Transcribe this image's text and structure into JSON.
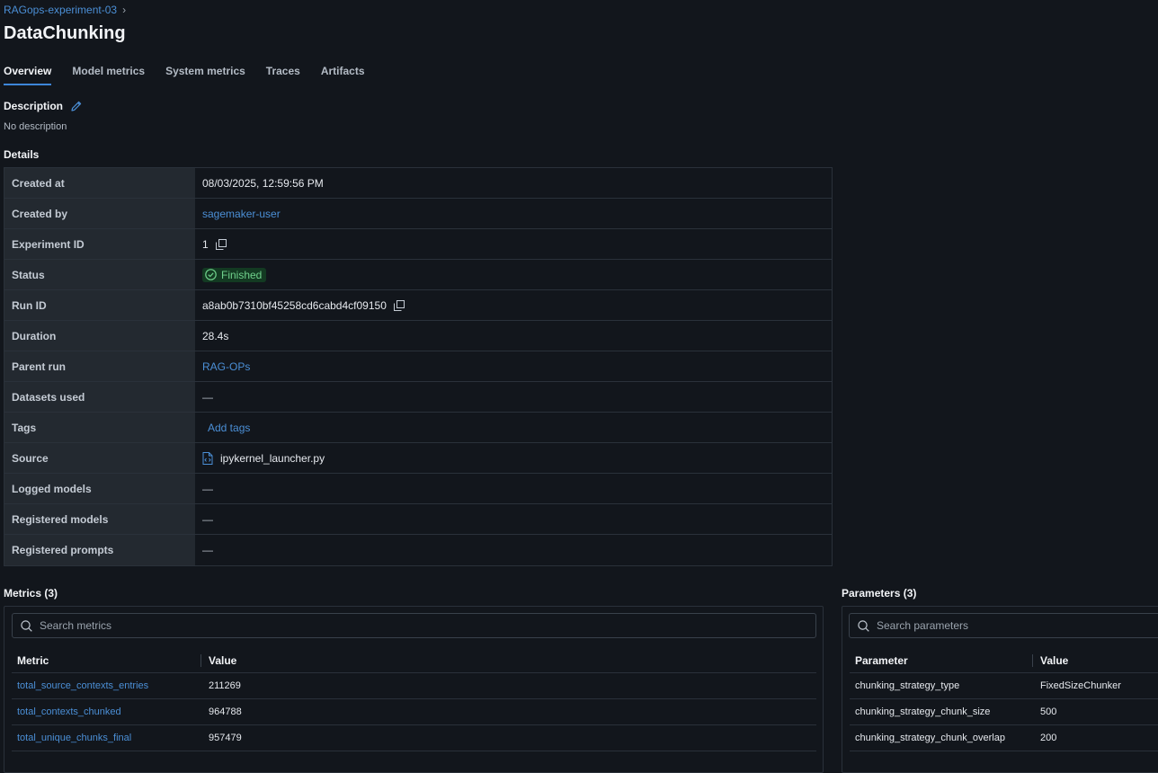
{
  "breadcrumb": {
    "experiment": "RAGops-experiment-03",
    "chevron": "›"
  },
  "title": "DataChunking",
  "tabs": [
    {
      "label": "Overview",
      "active": true
    },
    {
      "label": "Model metrics"
    },
    {
      "label": "System metrics"
    },
    {
      "label": "Traces"
    },
    {
      "label": "Artifacts"
    }
  ],
  "description": {
    "heading": "Description",
    "text": "No description",
    "edit_icon": "pencil-icon"
  },
  "details": {
    "heading": "Details",
    "rows": {
      "created_at": {
        "key": "Created at",
        "value": "08/03/2025, 12:59:56 PM"
      },
      "created_by": {
        "key": "Created by",
        "value": "sagemaker-user"
      },
      "experiment_id": {
        "key": "Experiment ID",
        "value": "1"
      },
      "status": {
        "key": "Status",
        "value": "Finished",
        "color": "#6fd18c"
      },
      "run_id": {
        "key": "Run ID",
        "value": "a8ab0b7310bf45258cd6cabd4cf09150"
      },
      "duration": {
        "key": "Duration",
        "value": "28.4s"
      },
      "parent_run": {
        "key": "Parent run",
        "value": "RAG-OPs"
      },
      "datasets_used": {
        "key": "Datasets used",
        "value": "—"
      },
      "tags": {
        "key": "Tags",
        "value": "Add tags"
      },
      "source": {
        "key": "Source",
        "value": "ipykernel_launcher.py"
      },
      "logged_models": {
        "key": "Logged models",
        "value": "—"
      },
      "registered_models": {
        "key": "Registered models",
        "value": "—"
      },
      "registered_prompts": {
        "key": "Registered prompts",
        "value": "—"
      }
    }
  },
  "metrics": {
    "title": "Metrics (3)",
    "search_placeholder": "Search metrics",
    "columns": [
      "Metric",
      "Value"
    ],
    "rows": [
      [
        "total_source_contexts_entries",
        "211269"
      ],
      [
        "total_contexts_chunked",
        "964788"
      ],
      [
        "total_unique_chunks_final",
        "957479"
      ]
    ]
  },
  "parameters": {
    "title": "Parameters (3)",
    "search_placeholder": "Search parameters",
    "columns": [
      "Parameter",
      "Value"
    ],
    "rows": [
      [
        "chunking_strategy_type",
        "FixedSizeChunker"
      ],
      [
        "chunking_strategy_chunk_size",
        "500"
      ],
      [
        "chunking_strategy_chunk_overlap",
        "200"
      ]
    ]
  },
  "colors": {
    "link": "#4b8fd6",
    "accent": "#3d86d8",
    "background": "#12161c"
  }
}
